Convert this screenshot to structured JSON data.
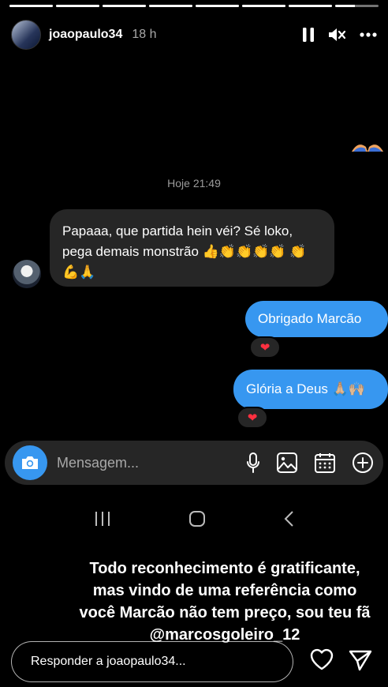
{
  "story": {
    "progress_segments": [
      1,
      1,
      1,
      1,
      1,
      1,
      1,
      0.45
    ],
    "username": "joaopaulo34",
    "time_ago": "18 h"
  },
  "chat": {
    "timestamp": "Hoje 21:49",
    "incoming": {
      "text": "Papaaa, que partida hein véi? Sé loko, pega demais monstrão 👍👏👏👏👏 👏💪🙏"
    },
    "outgoing": [
      {
        "text": "Obrigado Marcão",
        "reaction": "❤"
      },
      {
        "text": "Glória a Deus 🙏🏼🙌🏼",
        "reaction": "❤"
      }
    ],
    "composer_placeholder": "Mensagem..."
  },
  "caption": "Todo reconhecimento é gratificante, mas vindo de uma referência como você Marcão não tem preço, sou teu fã @marcosgoleiro_12",
  "reply": {
    "placeholder": "Responder a joaopaulo34..."
  },
  "icons": {
    "header": [
      "pause-icon",
      "mute-icon",
      "more-icon"
    ],
    "composer": [
      "camera-icon",
      "microphone-icon",
      "gallery-icon",
      "sticker-icon",
      "add-icon"
    ],
    "reply": [
      "heart-icon",
      "send-icon"
    ],
    "navbar": [
      "recent-apps-icon",
      "home-icon",
      "back-icon"
    ]
  },
  "colors": {
    "accent_blue": "#3797f0",
    "bubble_gray": "#262626",
    "reaction_red": "#ff3040"
  }
}
